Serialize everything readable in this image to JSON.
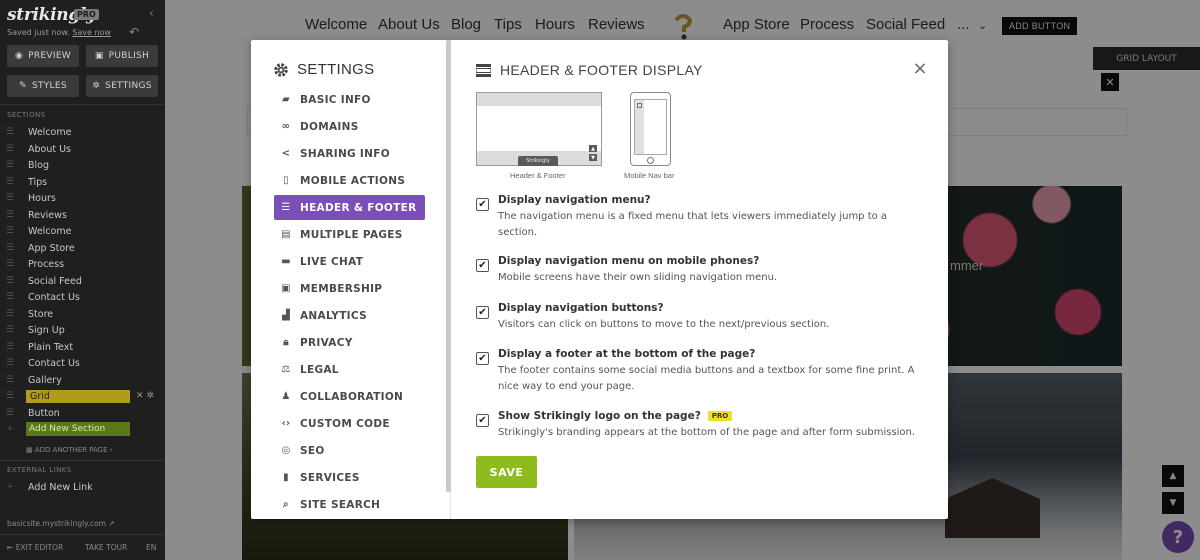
{
  "sidebar": {
    "brand": "strikingly",
    "pro": "PRO",
    "saved_text": "Saved just now.",
    "save_now": "Save now",
    "preview": "PREVIEW",
    "publish": "PUBLISH",
    "styles": "STYLES",
    "settings": "SETTINGS",
    "sections_title": "SECTIONS",
    "sections": [
      {
        "label": "Welcome"
      },
      {
        "label": "About Us"
      },
      {
        "label": "Blog"
      },
      {
        "label": "Tips"
      },
      {
        "label": "Hours"
      },
      {
        "label": "Reviews"
      },
      {
        "label": "Welcome"
      },
      {
        "label": "App Store"
      },
      {
        "label": "Process"
      },
      {
        "label": "Social Feed"
      },
      {
        "label": "Contact Us"
      },
      {
        "label": "Store"
      },
      {
        "label": "Sign Up"
      },
      {
        "label": "Plain Text"
      },
      {
        "label": "Contact Us"
      },
      {
        "label": "Gallery"
      },
      {
        "label": "Grid"
      },
      {
        "label": "Button"
      }
    ],
    "add_section": "Add New Section",
    "add_page": "ADD ANOTHER PAGE",
    "external_links_title": "EXTERNAL LINKS",
    "add_link": "Add New Link",
    "site_url": "basicsite.mystrikingly.com",
    "exit_editor": "EXIT EDITOR",
    "take_tour": "TAKE TOUR",
    "language": "EN"
  },
  "page": {
    "nav": [
      "Welcome",
      "About Us",
      "Blog",
      "Tips",
      "Hours",
      "Reviews",
      "App Store",
      "Process",
      "Social Feed",
      "..."
    ],
    "add_button": "ADD BUTTON",
    "grid_layout": "GRID LAYOUT",
    "summer_text": "mmer",
    "help": "?"
  },
  "modal": {
    "title": "SETTINGS",
    "nav": [
      {
        "label": "BASIC INFO",
        "icon": "briefcase-icon"
      },
      {
        "label": "DOMAINS",
        "icon": "link-icon"
      },
      {
        "label": "SHARING INFO",
        "icon": "share-icon"
      },
      {
        "label": "MOBILE ACTIONS",
        "icon": "mobile-icon"
      },
      {
        "label": "HEADER & FOOTER",
        "icon": "header-footer-icon"
      },
      {
        "label": "MULTIPLE PAGES",
        "icon": "pages-icon"
      },
      {
        "label": "LIVE CHAT",
        "icon": "chat-icon"
      },
      {
        "label": "MEMBERSHIP",
        "icon": "membership-icon"
      },
      {
        "label": "ANALYTICS",
        "icon": "analytics-icon"
      },
      {
        "label": "PRIVACY",
        "icon": "lock-icon"
      },
      {
        "label": "LEGAL",
        "icon": "legal-icon"
      },
      {
        "label": "COLLABORATION",
        "icon": "people-icon"
      },
      {
        "label": "CUSTOM CODE",
        "icon": "code-icon"
      },
      {
        "label": "SEO",
        "icon": "seo-icon"
      },
      {
        "label": "SERVICES",
        "icon": "services-icon"
      },
      {
        "label": "SITE SEARCH",
        "icon": "search-icon"
      }
    ],
    "selected_index": 4,
    "heading": "HEADER & FOOTER DISPLAY",
    "preview_desktop_caption": "Header & Footer",
    "preview_mobile_caption": "Mobile Nav bar",
    "preview_brand": "Strikingly",
    "options": [
      {
        "title": "Display navigation menu?",
        "desc": "The navigation menu is a fixed menu that lets viewers immediately jump to a section.",
        "checked": true
      },
      {
        "title": "Display navigation menu on mobile phones?",
        "desc": "Mobile screens have their own sliding navigation menu.",
        "checked": true
      },
      {
        "title": "Display navigation buttons?",
        "desc": "Visitors can click on buttons to move to the next/previous section.",
        "checked": true
      },
      {
        "title": "Display a footer at the bottom of the page?",
        "desc": "The footer contains some social media buttons and a textbox for some fine print. A nice way to end your page.",
        "checked": true
      },
      {
        "title": "Show Strikingly logo on the page?",
        "desc": "Strikingly's branding appears at the bottom of the page and after form submission.",
        "checked": true,
        "badge": "PRO"
      }
    ],
    "save": "SAVE"
  },
  "colors": {
    "accent_purple": "#7a4fb8",
    "save_green": "#8ebc1e",
    "pro_yellow": "#f2dc2a"
  }
}
